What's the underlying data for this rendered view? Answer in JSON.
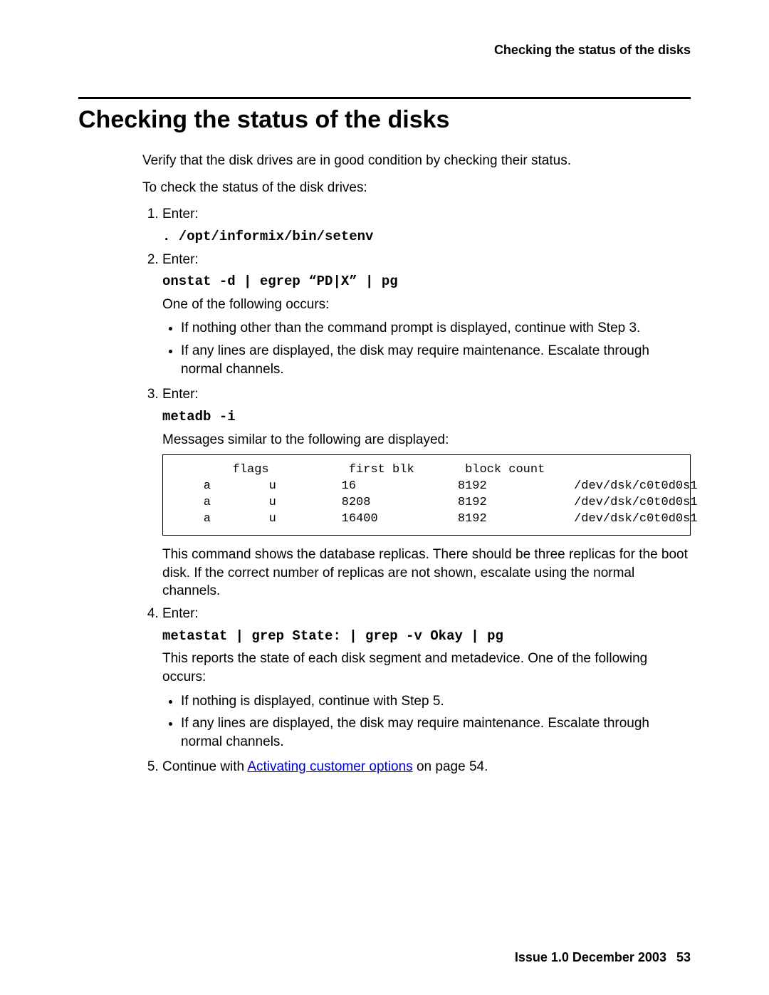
{
  "header": {
    "running_title": "Checking the status of the disks"
  },
  "title": "Checking the status of the disks",
  "intro": {
    "p1": "Verify that the disk drives are in good condition by checking their status.",
    "p2": "To check the status of the disk drives:"
  },
  "steps": {
    "s1": {
      "lead": "Enter:",
      "cmd": ". /opt/informix/bin/setenv"
    },
    "s2": {
      "lead": "Enter:",
      "cmd": "onstat -d | egrep “PD|X” | pg",
      "after": "One of the following occurs:",
      "b1": "If nothing other than the command prompt is displayed, continue with Step 3.",
      "b2": "If any lines are displayed, the disk may require maintenance. Escalate through normal channels."
    },
    "s3": {
      "lead": "Enter:",
      "cmd": "metadb -i",
      "after": "Messages similar to the following are displayed:",
      "output": "        flags           first blk       block count\n    a        u         16              8192            /dev/dsk/c0t0d0s1\n    a        u         8208            8192            /dev/dsk/c0t0d0s1\n    a        u         16400           8192            /dev/dsk/c0t0d0s1",
      "tail": "This command shows the database replicas. There should be three replicas for the boot disk. If the correct number of replicas are not shown, escalate using the normal channels."
    },
    "s4": {
      "lead": "Enter:",
      "cmd": "metastat | grep State: | grep -v Okay | pg",
      "after": "This reports the state of each disk segment and metadevice. One of the following occurs:",
      "b1": "If nothing is displayed, continue with Step 5.",
      "b2": "If any lines are displayed, the disk may require maintenance. Escalate through normal channels."
    },
    "s5": {
      "pre": "Continue with ",
      "link": "Activating customer options",
      "post": " on page 54."
    }
  },
  "footer": {
    "issue": "Issue 1.0   December 2003",
    "page": "53"
  }
}
